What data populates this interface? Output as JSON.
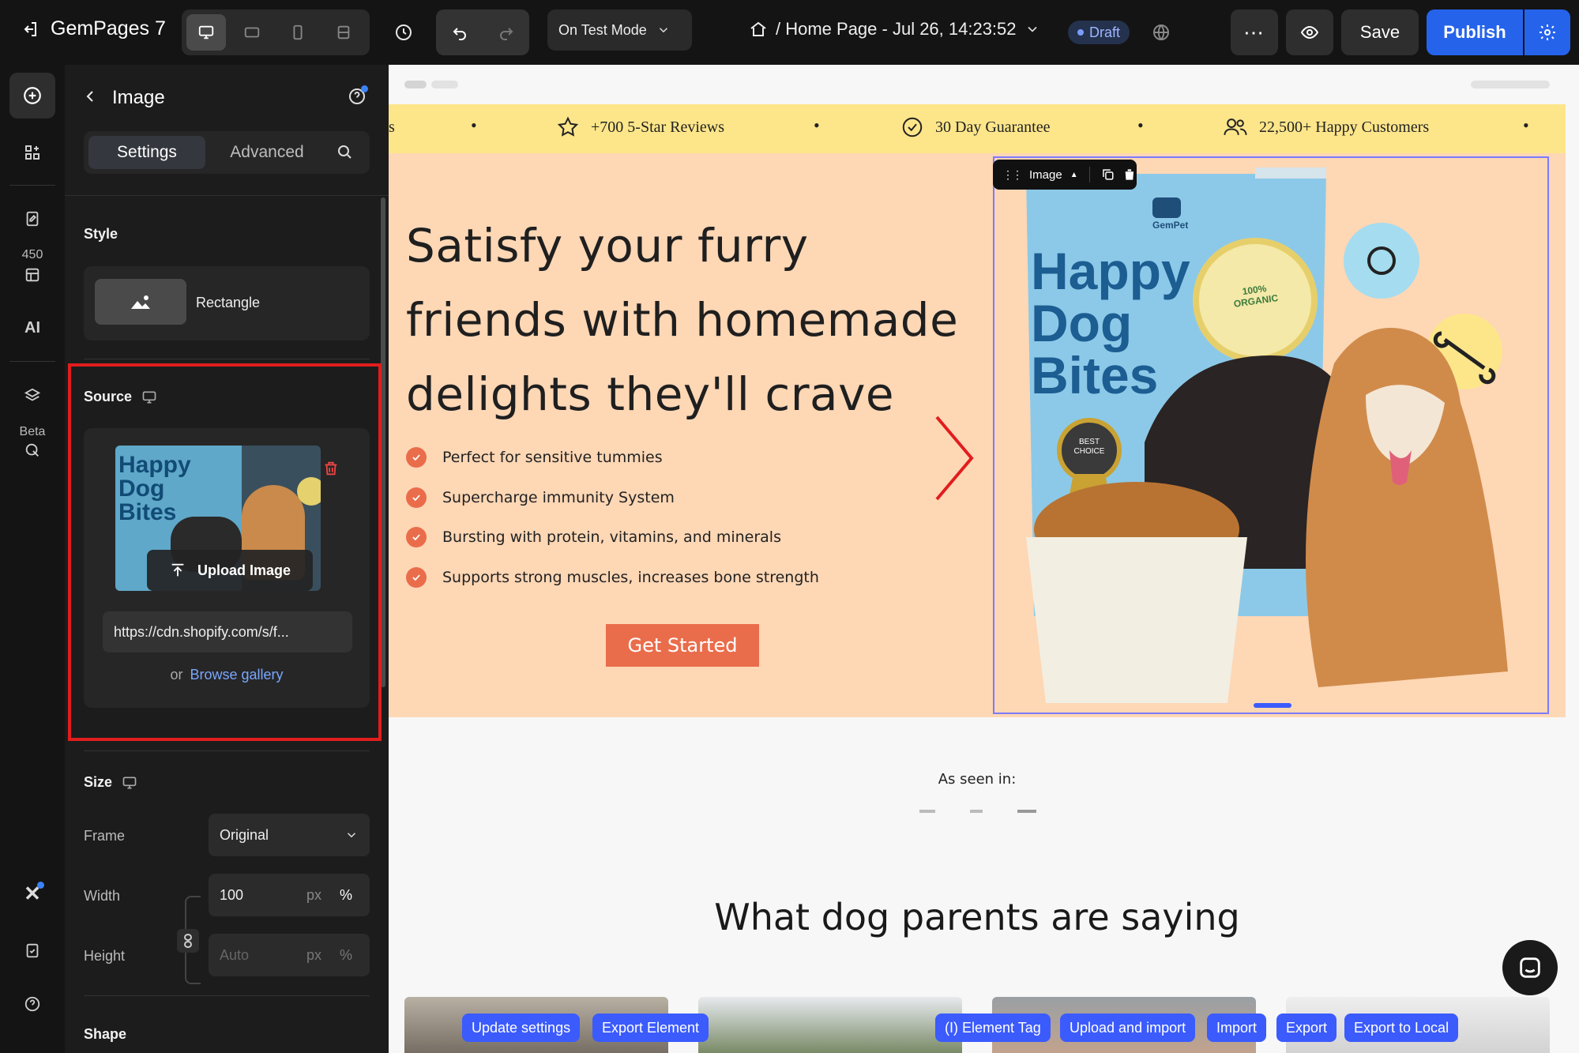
{
  "topbar": {
    "app_name": "GemPages 7",
    "mode_label": "On Test Mode",
    "page_title": "/ Home Page - Jul 26, 14:23:52",
    "status_badge": "Draft",
    "save_label": "Save",
    "publish_label": "Publish"
  },
  "leftnav": {
    "count_badge": "450",
    "ai_label": "AI",
    "beta_label": "Beta"
  },
  "panel": {
    "title": "Image",
    "tabs": [
      "Settings",
      "Advanced"
    ],
    "style_label": "Style",
    "style_value": "Rectangle",
    "source_label": "Source",
    "upload_label": "Upload Image",
    "url_value": "https://cdn.shopify.com/s/f...",
    "or_text": "or",
    "browse_label": "Browse gallery",
    "size_label": "Size",
    "frame_label": "Frame",
    "frame_value": "Original",
    "width_label": "Width",
    "width_value": "100",
    "height_label": "Height",
    "height_placeholder": "Auto",
    "unit_px": "px",
    "unit_pct": "%",
    "shape_label": "Shape",
    "thumb_text": [
      "Happy",
      "Dog",
      "Bites"
    ]
  },
  "canvas": {
    "announcements": [
      "+700 5-Star Reviews",
      "30 Day Guarantee",
      "22,500+ Happy Customers"
    ],
    "hero_title": "Satisfy your furry friends with homemade delights they'll crave",
    "bullets": [
      "Perfect for sensitive tummies",
      "Supercharge immunity System",
      "Bursting with protein, vitamins, and minerals",
      "Supports strong muscles, increases bone strength"
    ],
    "cta_label": "Get Started",
    "image_tool_label": "Image",
    "product": {
      "brand": "GemPet",
      "lines": [
        "Happy",
        "Dog",
        "Bites"
      ],
      "seal_top": "100%",
      "seal_main": "ORGANIC",
      "badge_top": "BEST",
      "badge_bottom": "CHOICE"
    },
    "as_seen_in": "As seen in:",
    "testimonials_title": "What dog parents are saying"
  },
  "toolbar_chips": [
    "Update settings",
    "Export Element",
    "(I) Element Tag",
    "Upload and import",
    "Import",
    "Export",
    "Export to Local"
  ],
  "colors": {
    "accent_blue": "#2563eb",
    "cta_orange": "#ea6d4b",
    "hero_bg": "#fed7b5",
    "announce_bg": "#fde68a",
    "highlight_red": "#e11d1d"
  }
}
